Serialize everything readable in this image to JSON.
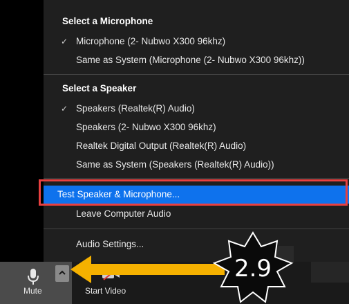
{
  "menu": {
    "mic_title": "Select a Microphone",
    "mic_items": [
      {
        "label": "Microphone (2- Nubwo X300  96khz)",
        "checked": true
      },
      {
        "label": "Same as System (Microphone (2- Nubwo X300  96khz))",
        "checked": false
      }
    ],
    "speaker_title": "Select a Speaker",
    "speaker_items": [
      {
        "label": "Speakers (Realtek(R) Audio)",
        "checked": true
      },
      {
        "label": "Speakers (2- Nubwo X300  96khz)",
        "checked": false
      },
      {
        "label": "Realtek Digital Output (Realtek(R) Audio)",
        "checked": false
      },
      {
        "label": "Same as System (Speakers (Realtek(R) Audio))",
        "checked": false
      }
    ],
    "test_label": "Test Speaker & Microphone...",
    "leave_label": "Leave Computer Audio",
    "settings_label": "Audio Settings..."
  },
  "toolbar": {
    "mute_label": "Mute",
    "video_label": "Start Video"
  },
  "annotation": {
    "badge_text": "2.9",
    "arrow_color": "#f5b100",
    "highlight_color": "#e84040"
  },
  "colors": {
    "menu_bg": "#1f1f1f",
    "active_bg": "#0e72ed"
  }
}
